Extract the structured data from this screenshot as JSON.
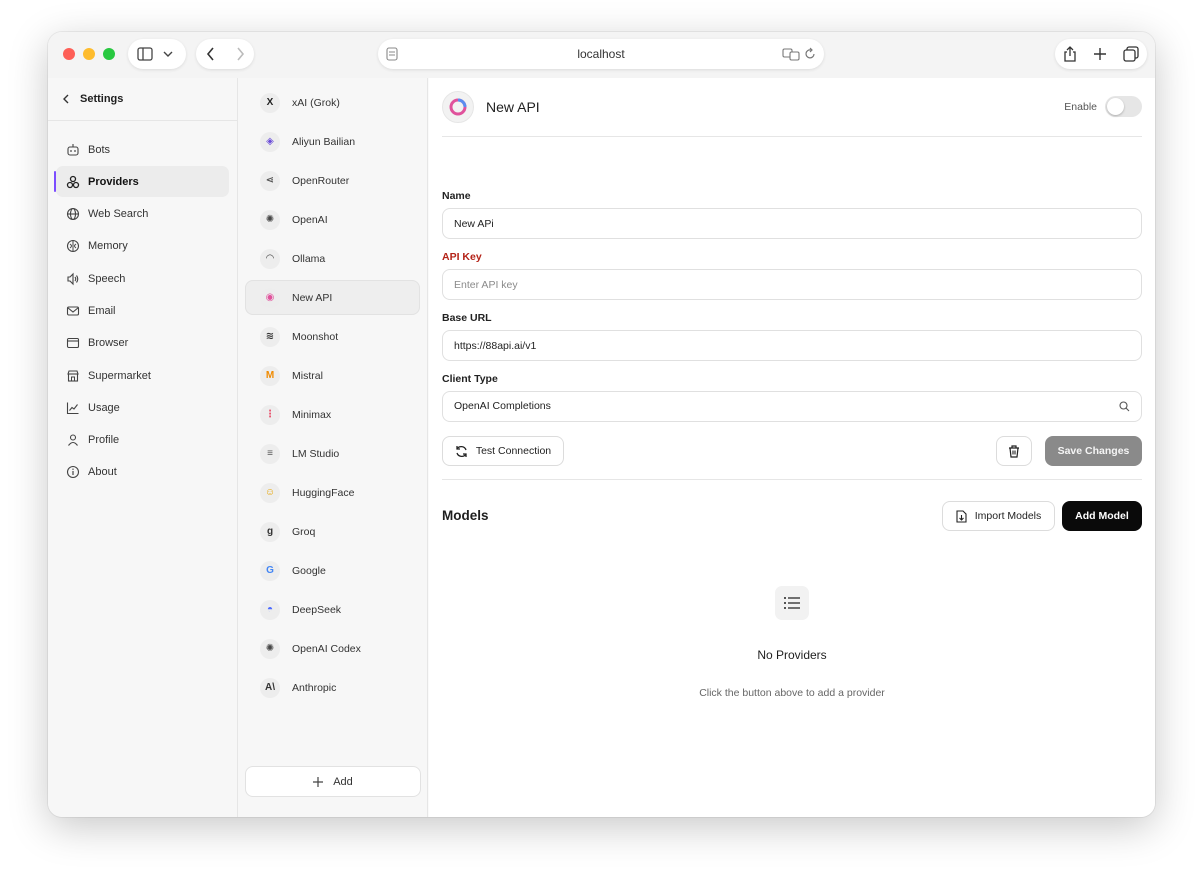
{
  "browser": {
    "url": "localhost"
  },
  "settings": {
    "back_title": "Settings",
    "nav": [
      {
        "label": "Bots",
        "icon": "bot-icon",
        "active": false
      },
      {
        "label": "Providers",
        "icon": "providers-icon",
        "active": true
      },
      {
        "label": "Web Search",
        "icon": "globe-icon",
        "active": false
      },
      {
        "label": "Memory",
        "icon": "brain-icon",
        "active": false
      },
      {
        "label": "Speech",
        "icon": "speaker-icon",
        "active": false
      },
      {
        "label": "Email",
        "icon": "mail-icon",
        "active": false
      },
      {
        "label": "Browser",
        "icon": "browser-window-icon",
        "active": false
      },
      {
        "label": "Supermarket",
        "icon": "store-icon",
        "active": false
      },
      {
        "label": "Usage",
        "icon": "chart-line-icon",
        "active": false
      },
      {
        "label": "Profile",
        "icon": "user-icon",
        "active": false
      },
      {
        "label": "About",
        "icon": "info-icon",
        "active": false
      }
    ]
  },
  "providers": {
    "items": [
      {
        "label": "xAI (Grok)",
        "logo": "X",
        "logo_color": "#222222",
        "active": false
      },
      {
        "label": "Aliyun Bailian",
        "logo": "◈",
        "logo_color": "#6a4cd8",
        "active": false
      },
      {
        "label": "OpenRouter",
        "logo": "⋖",
        "logo_color": "#555555",
        "active": false
      },
      {
        "label": "OpenAI",
        "logo": "✺",
        "logo_color": "#444444",
        "active": false
      },
      {
        "label": "Ollama",
        "logo": "◠",
        "logo_color": "#444444",
        "active": false
      },
      {
        "label": "New API",
        "logo": "◉",
        "logo_color": "#e0529c",
        "active": true
      },
      {
        "label": "Moonshot",
        "logo": "≋",
        "logo_color": "#333333",
        "active": false
      },
      {
        "label": "Mistral",
        "logo": "M",
        "logo_color": "#f08a00",
        "active": false
      },
      {
        "label": "Minimax",
        "logo": "⋮",
        "logo_color": "#e8506b",
        "active": false
      },
      {
        "label": "LM Studio",
        "logo": "≡",
        "logo_color": "#555555",
        "active": false
      },
      {
        "label": "HuggingFace",
        "logo": "☺",
        "logo_color": "#e7a400",
        "active": false
      },
      {
        "label": "Groq",
        "logo": "g",
        "logo_color": "#333333",
        "active": false
      },
      {
        "label": "Google",
        "logo": "G",
        "logo_color": "#4285f4",
        "active": false
      },
      {
        "label": "DeepSeek",
        "logo": "◓",
        "logo_color": "#4d6bfe",
        "active": false
      },
      {
        "label": "OpenAI Codex",
        "logo": "✺",
        "logo_color": "#444444",
        "active": false
      },
      {
        "label": "Anthropic",
        "logo": "A\\",
        "logo_color": "#333333",
        "active": false
      }
    ],
    "add_label": "Add"
  },
  "detail": {
    "title": "New API",
    "enable_label": "Enable",
    "enabled": false,
    "name_label": "Name",
    "name_value": "New APi",
    "api_key_label": "API Key",
    "api_key_placeholder": "Enter API key",
    "base_url_label": "Base URL",
    "base_url_value": "https://88api.ai/v1",
    "client_type_label": "Client Type",
    "client_type_value": "OpenAI Completions",
    "test_label": "Test Connection",
    "save_label": "Save Changes"
  },
  "models": {
    "title": "Models",
    "import_label": "Import Models",
    "add_label": "Add Model",
    "empty_title": "No Providers",
    "empty_subtitle": "Click the button above to add a provider"
  },
  "colors": {
    "accent": "#7c4dff",
    "required": "#b42318",
    "save_disabled": "#8a8a8a",
    "primary_button": "#0a0a0a"
  }
}
